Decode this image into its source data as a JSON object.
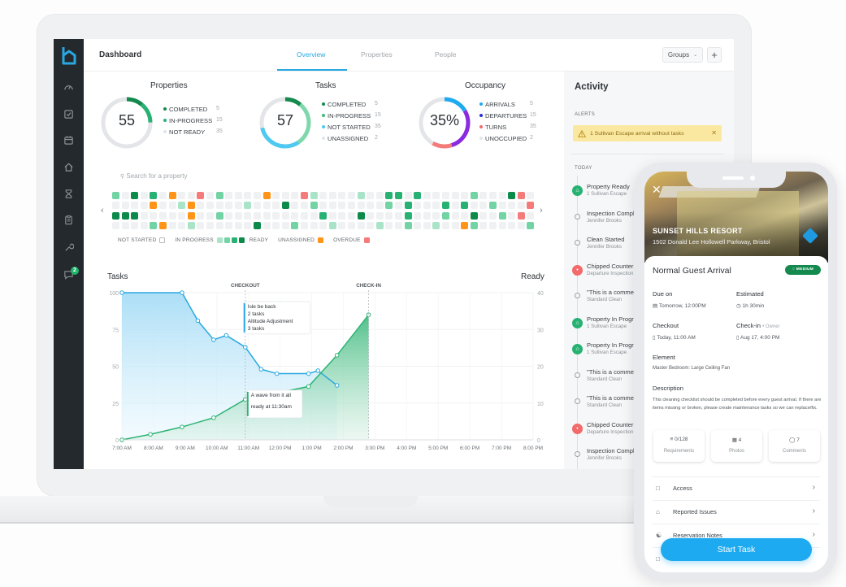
{
  "app": {
    "title": "Dashboard",
    "tabs": [
      {
        "label": "Overview",
        "active": true
      },
      {
        "label": "Properties",
        "active": false
      },
      {
        "label": "People",
        "active": false
      }
    ],
    "groups_label": "Groups",
    "add_label": "+",
    "accent": "#29a8e0"
  },
  "sidebar": {
    "items": [
      {
        "icon": "speedometer-icon"
      },
      {
        "icon": "checkbox-icon"
      },
      {
        "icon": "calendar-icon"
      },
      {
        "icon": "home-icon"
      },
      {
        "icon": "hourglass-icon"
      },
      {
        "icon": "clipboard-icon"
      },
      {
        "icon": "wrench-icon"
      },
      {
        "icon": "chat-icon",
        "badge": "2"
      }
    ]
  },
  "summary": {
    "properties": {
      "title": "Properties",
      "value": "55",
      "legend": [
        {
          "label": "COMPLETED",
          "count": "5",
          "color": "#138a4d"
        },
        {
          "label": "IN-PROGRESS",
          "count": "15",
          "color": "#27b273"
        },
        {
          "label": "NOT READY",
          "count": "35",
          "color": "#e3e5e8"
        }
      ]
    },
    "tasks": {
      "title": "Tasks",
      "value": "57",
      "legend": [
        {
          "label": "COMPLETED",
          "count": "5",
          "color": "#138a4d"
        },
        {
          "label": "IN-PROGRESS",
          "count": "15",
          "color": "#3dba7d"
        },
        {
          "label": "NOT STARTED",
          "count": "35",
          "color": "#4fc9f0"
        },
        {
          "label": "UNASSIGNED",
          "count": "2",
          "color": "#e3e5e8"
        }
      ]
    },
    "occupancy": {
      "title": "Occupancy",
      "value": "35%",
      "legend": [
        {
          "label": "ARRIVALS",
          "count": "5",
          "color": "#1eaaf0"
        },
        {
          "label": "DEPARTURES",
          "count": "15",
          "color": "#2b2fd6"
        },
        {
          "label": "TURNS",
          "count": "35",
          "color": "#f26a6a"
        },
        {
          "label": "UNOCCUPIED",
          "count": "2",
          "color": "#e3e5e8"
        }
      ]
    }
  },
  "property_grid": {
    "search_placeholder": "Search for a property",
    "legend": {
      "not_started": "NOT STARTED",
      "in_progress": "IN PROGRESS",
      "ready": "READY",
      "unassigned": "UNASSIGNED",
      "overdue": "OVERDUE"
    },
    "colors": {
      "0": "#eff1f3",
      "1": "#a9e4c8",
      "2": "#72d3a5",
      "3": "#27b273",
      "4": "#0c8a4a",
      "o": "#ff9419",
      "r": "#f57b7b"
    },
    "rows": [
      "204030o00r020000o000r1000010033030000020004r00",
      "0000o001o00000100040020000000203000303002000r02",
      "44400000o0020000000000300040000300020040020r00",
      "00002o0010000004000200010000100200100o200000200"
    ]
  },
  "chart_data": {
    "type": "area",
    "title": "Tasks",
    "ylabel": "Tasks",
    "y2label": "Ready",
    "xlabel": "",
    "x_ticks": [
      "7:00 AM",
      "8:00 AM",
      "9:00 AM",
      "10:00 AM",
      "11:00 AM",
      "12:00 PM",
      "1:00 PM",
      "2:00 PM",
      "3:00 PM",
      "4:00 PM",
      "5:00 PM",
      "6:00 PM",
      "7:00 PM",
      "8:00 PM"
    ],
    "xlim_hours": [
      7,
      20
    ],
    "ylim": [
      0,
      100
    ],
    "y_ticks": [
      0,
      25,
      50,
      75,
      100
    ],
    "y2lim": [
      0,
      40
    ],
    "y2_ticks": [
      0,
      10,
      20,
      30,
      40
    ],
    "grid": true,
    "series": [
      {
        "name": "Tasks",
        "axis": "left",
        "color": "#29a8e0",
        "x": [
          7.0,
          8.9,
          9.4,
          9.9,
          10.3,
          10.9,
          11.4,
          11.9,
          12.9,
          13.2,
          13.8
        ],
        "values": [
          100,
          100,
          81,
          68,
          71,
          63,
          48,
          45,
          45,
          47,
          37
        ]
      },
      {
        "name": "Ready",
        "axis": "right",
        "color": "#2db374",
        "x": [
          7.0,
          7.9,
          8.9,
          9.9,
          10.9,
          12.9,
          13.8,
          14.8
        ],
        "values": [
          0,
          1.5,
          3.5,
          6,
          11,
          14.5,
          23,
          34
        ]
      }
    ],
    "markers": [
      {
        "label": "CHECKOUT",
        "x": 10.9
      },
      {
        "label": "CHECK-IN",
        "x": 14.8
      }
    ],
    "annotations": [
      {
        "lines": [
          "Isle be back",
          "2 tasks",
          "Altitude Adjustment",
          "3 tasks"
        ],
        "color": "#29a8e0"
      },
      {
        "lines": [
          "A wave from it all",
          "ready at 11:30am"
        ],
        "color": "#2db374"
      }
    ]
  },
  "activity": {
    "title": "Activity",
    "alerts_label": "ALERTS",
    "alert_text": "1 Sullivan Escape arrival without tasks",
    "today_label": "TODAY",
    "items": [
      {
        "title": "Property Ready",
        "sub": "1 Sullivan Escape",
        "type": "green"
      },
      {
        "title": "Inspection Completed",
        "sub": "Jennifer Brooks",
        "type": "hollow"
      },
      {
        "title": "Clean Started",
        "sub": "Jennifer Brooks",
        "type": "hollow"
      },
      {
        "title": "Chipped Counter",
        "sub": "Departure Inspection",
        "type": "red"
      },
      {
        "title": "\"This is a comment",
        "sub": "Standard Clean",
        "type": "hollow"
      },
      {
        "title": "Property In Progress",
        "sub": "1 Sullivan Escape",
        "type": "green"
      },
      {
        "title": "Property In Progress",
        "sub": "1 Sullivan Escape",
        "type": "green"
      },
      {
        "title": "\"This is a comment",
        "sub": "Standard Clean",
        "type": "hollow"
      },
      {
        "title": "\"This is a comment",
        "sub": "Standard Clean",
        "type": "hollow"
      },
      {
        "title": "Chipped Counter",
        "sub": "Departure Inspection",
        "type": "red"
      },
      {
        "title": "Inspection Completed",
        "sub": "Jennifer Brooks",
        "type": "hollow"
      }
    ]
  },
  "mobile": {
    "property_name": "SUNSET HILLS RESORT",
    "address": "1502 Donald Lee Hollowell Parkway, Bristol",
    "task_title": "Normal Guest Arrival",
    "priority": "MEDIUM",
    "priority_color": "#148a4e",
    "due_label": "Due on",
    "due_value": "Tomorrow, 12:00PM",
    "estimated_label": "Estimated",
    "estimated_value": "1h 30min",
    "checkout_label": "Checkout",
    "checkout_value": "Today, 11:00 AM",
    "checkin_label": "Check-in",
    "checkin_sub": "• Owner",
    "checkin_value": "Aug 17, 4:00 PM",
    "element_label": "Element",
    "element_value": "Master Bedroom: Large Ceiling Fan",
    "description_label": "Description",
    "description_text": "This cleaning checklist should be completed before every guest arrival. If there are items missing or broken, please create maintenance tasks so we can replace/fix.",
    "stats": [
      {
        "icon": "checklist-icon",
        "value": "0/128",
        "label": "Requirements"
      },
      {
        "icon": "photo-icon",
        "value": "4",
        "label": "Photos"
      },
      {
        "icon": "comment-icon",
        "value": "7",
        "label": "Comments"
      }
    ],
    "list": [
      {
        "icon": "lock-icon",
        "label": "Access"
      },
      {
        "icon": "house-alert-icon",
        "label": "Reported Issues"
      },
      {
        "icon": "person-icon",
        "label": "Reservation Notes"
      },
      {
        "icon": "clipboard-icon",
        "label": ""
      }
    ],
    "start_label": "Start Task"
  }
}
